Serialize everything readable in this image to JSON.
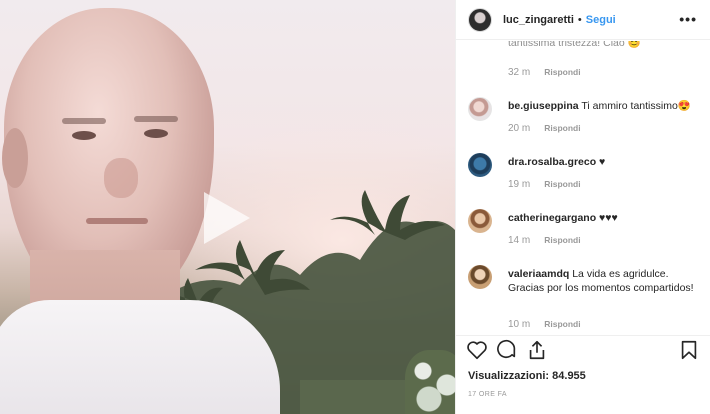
{
  "post": {
    "username": "luc_zingaretti",
    "separator": "•",
    "follow_label": "Segui",
    "more_label": "•••"
  },
  "comments": [
    {
      "user": "",
      "text": "tantissima tristezza! Ciao 😊",
      "time": "32 m",
      "reply": "Rispondi"
    },
    {
      "user": "be.giuseppina",
      "text": "Ti ammiro tantissimo😍",
      "time": "20 m",
      "reply": "Rispondi"
    },
    {
      "user": "dra.rosalba.greco",
      "text": "♥",
      "time": "19 m",
      "reply": "Rispondi"
    },
    {
      "user": "catherinegargano",
      "text": "♥♥♥",
      "time": "14 m",
      "reply": "Rispondi"
    },
    {
      "user": "valeriaamdq",
      "text": "La vida es agridulce. Gracias por los momentos compartidos!",
      "time": "10 m",
      "reply": "Rispondi"
    }
  ],
  "stats": {
    "views": "Visualizzazioni: 84.955",
    "posted": "17 ORE FA"
  },
  "icons": {
    "like": "heart-outline-icon",
    "comment": "comment-bubble-icon",
    "share": "share-icon",
    "save": "bookmark-icon",
    "play": "play-icon"
  }
}
